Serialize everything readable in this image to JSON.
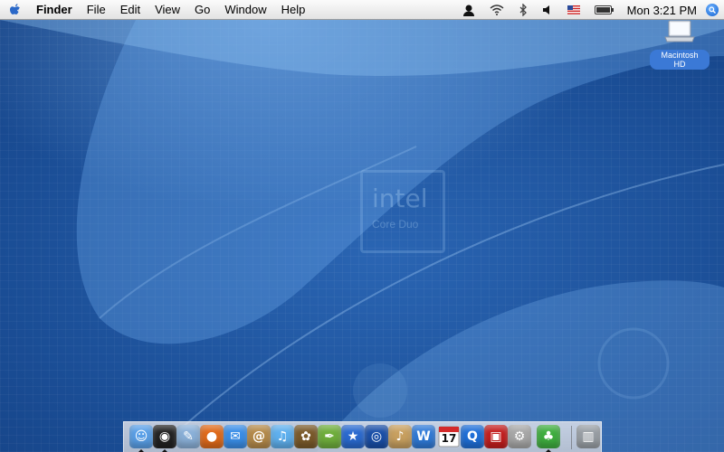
{
  "menubar": {
    "apple_icon": "apple-icon",
    "app_name": "Finder",
    "menus": [
      "File",
      "Edit",
      "View",
      "Go",
      "Window",
      "Help"
    ],
    "status_icons": [
      "user-icon",
      "wifi-icon",
      "bluetooth-icon",
      "volume-icon",
      "us-flag-icon",
      "battery-icon",
      "spotlight-icon"
    ],
    "clock": "Mon 3:21 PM"
  },
  "desktop": {
    "wallpaper_text": "intel",
    "wallpaper_subtext": "Core Duo",
    "drive_label": "Macintosh HD"
  },
  "dock": {
    "calendar_day": "17",
    "items": [
      {
        "name": "finder",
        "icon": "finder-icon",
        "color": "#5aa0e8",
        "running": true
      },
      {
        "name": "dashboard",
        "icon": "dashboard-icon",
        "color": "#222222",
        "running": true
      },
      {
        "name": "preview",
        "icon": "preview-icon",
        "color": "#8ab0d8",
        "running": false
      },
      {
        "name": "firefox",
        "icon": "firefox-icon",
        "color": "#e06a1a",
        "running": false
      },
      {
        "name": "ichat",
        "icon": "ichat-icon",
        "color": "#3a8ee8",
        "running": false
      },
      {
        "name": "address-book",
        "icon": "address-book-icon",
        "color": "#b58a4a",
        "running": false
      },
      {
        "name": "itunes",
        "icon": "itunes-icon",
        "color": "#5fb0ee",
        "running": false
      },
      {
        "name": "iphoto",
        "icon": "iphoto-icon",
        "color": "#7a5a2a",
        "running": false
      },
      {
        "name": "iweb",
        "icon": "iweb-icon",
        "color": "#6fae3c",
        "running": false
      },
      {
        "name": "imovie",
        "icon": "imovie-icon",
        "color": "#2a6ad0",
        "running": false
      },
      {
        "name": "idvd",
        "icon": "idvd-icon",
        "color": "#1a4fa8",
        "running": false
      },
      {
        "name": "garageband",
        "icon": "garageband-icon",
        "color": "#c8a060",
        "running": false
      },
      {
        "name": "iwork",
        "icon": "iwork-icon",
        "color": "#2f7ad8",
        "running": false
      },
      {
        "name": "ical",
        "icon": "ical-icon",
        "color": "#f2f2f2",
        "running": false
      },
      {
        "name": "quicktime",
        "icon": "quicktime-icon",
        "color": "#1f6fd8",
        "running": false
      },
      {
        "name": "photo-booth",
        "icon": "photo-booth-icon",
        "color": "#c41e1e",
        "running": false
      },
      {
        "name": "system-preferences",
        "icon": "system-preferences-icon",
        "color": "#a8a8a8",
        "running": false
      },
      {
        "name": "adium",
        "icon": "adium-icon",
        "color": "#3fae3f",
        "running": true
      },
      {
        "name": "trash",
        "icon": "trash-icon",
        "color": "#9aa0a6",
        "running": false
      }
    ]
  }
}
